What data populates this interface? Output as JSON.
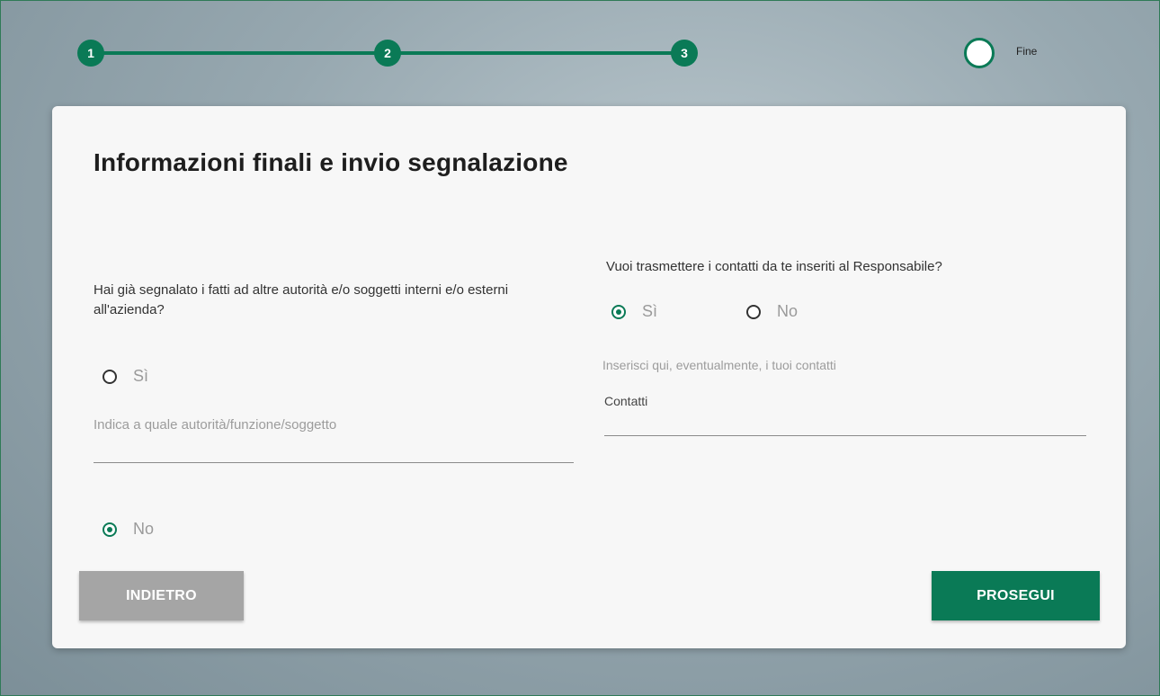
{
  "stepper": {
    "steps": [
      "1",
      "2",
      "3"
    ],
    "final_label": "Fine"
  },
  "title": "Informazioni finali e invio segnalazione",
  "left": {
    "question": "Hai già segnalato i fatti ad altre autorità e/o soggetti interni e/o esterni all'azienda?",
    "option_yes": "Sì",
    "option_yes_selected": false,
    "authority_placeholder": "Indica a quale autorità/funzione/soggetto",
    "option_no": "No",
    "option_no_selected": true
  },
  "right": {
    "question": "Vuoi trasmettere i contatti da te inseriti al Responsabile?",
    "option_yes": "Sì",
    "option_yes_selected": true,
    "option_no": "No",
    "option_no_selected": false,
    "hint": "Inserisci qui, eventualmente, i tuoi contatti",
    "contacts_label": "Contatti",
    "contacts_value": ""
  },
  "buttons": {
    "back": "INDIETRO",
    "next": "PROSEGUI"
  },
  "colors": {
    "accent": "#0a7a56",
    "back_button": "#a5a5a5"
  }
}
